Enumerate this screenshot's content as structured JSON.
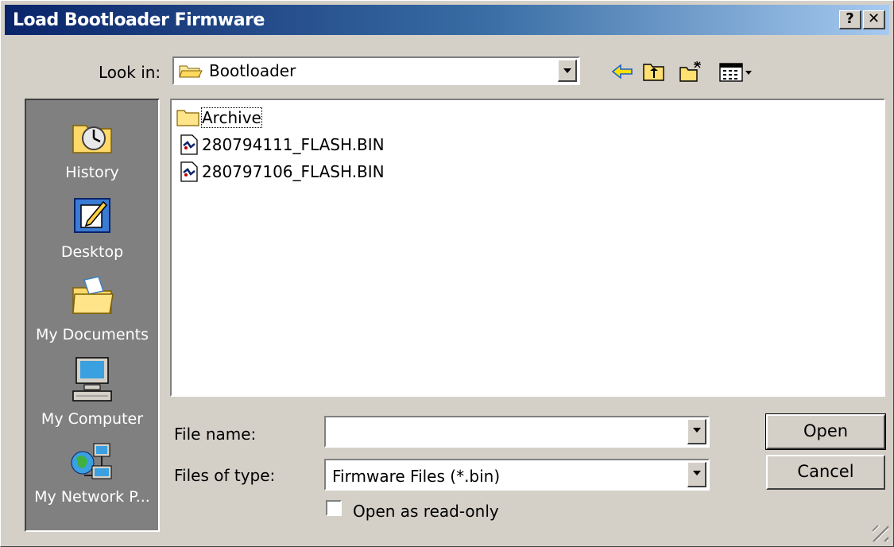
{
  "window": {
    "title": "Load Bootloader Firmware",
    "help_label": "?",
    "close_label": "✕",
    "title_gradient": [
      "#0a246a",
      "#a6caf0"
    ]
  },
  "lookin": {
    "label": "Look in:",
    "value": "Bootloader"
  },
  "toolbar": [
    "back-icon",
    "up-folder-icon",
    "new-folder-icon",
    "view-menu-icon"
  ],
  "places": [
    {
      "label": "History",
      "icon": "history-icon"
    },
    {
      "label": "Desktop",
      "icon": "desktop-icon"
    },
    {
      "label": "My Documents",
      "icon": "my-documents-icon"
    },
    {
      "label": "My Computer",
      "icon": "my-computer-icon"
    },
    {
      "label": "My Network P...",
      "icon": "my-network-icon"
    }
  ],
  "files": [
    {
      "name": "Archive",
      "type": "folder"
    },
    {
      "name": "280794111_FLASH.BIN",
      "type": "bin"
    },
    {
      "name": "280797106_FLASH.BIN",
      "type": "bin"
    }
  ],
  "form": {
    "filename_label": "File name:",
    "filename_value": "",
    "filetype_label": "Files of type:",
    "filetype_value": "Firmware Files (*.bin)",
    "readonly_label": "Open as read-only",
    "readonly_checked": false
  },
  "buttons": {
    "open": "Open",
    "cancel": "Cancel"
  }
}
